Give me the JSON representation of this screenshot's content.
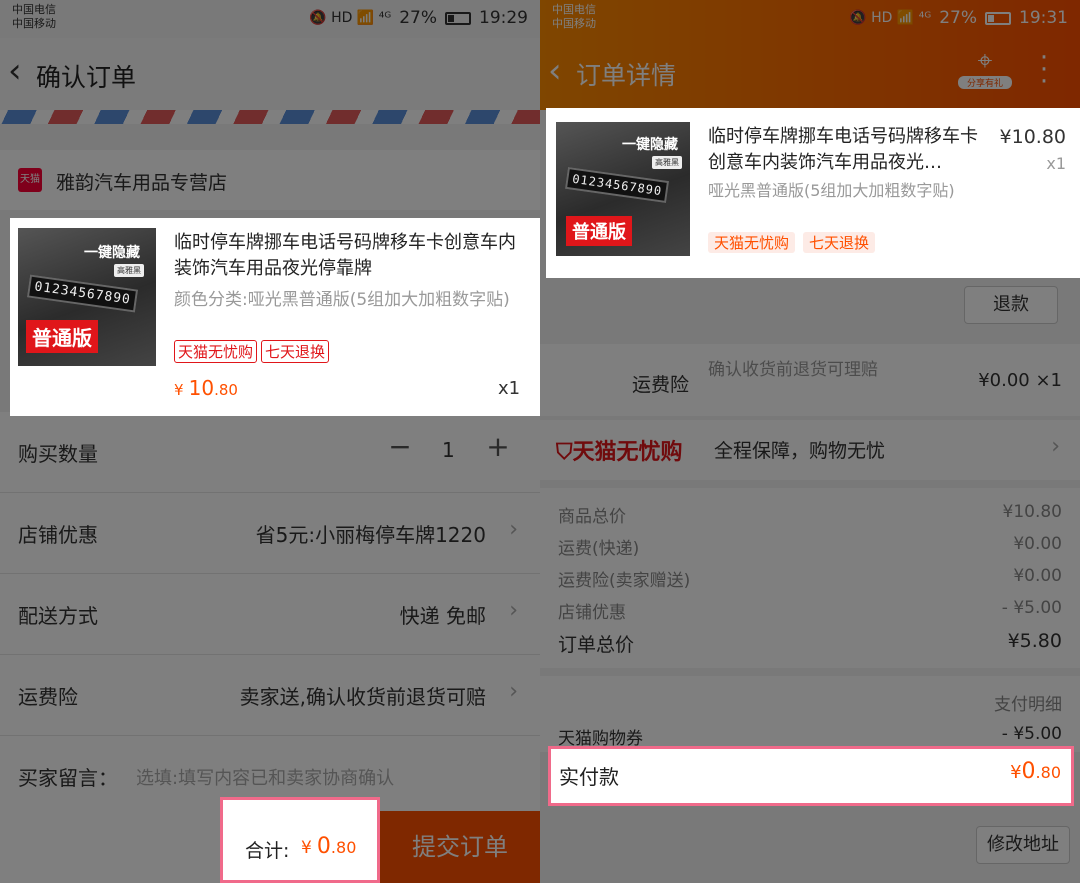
{
  "left": {
    "status": {
      "carrier1": "中国电信",
      "carrier2": "中国移动",
      "battery": "27%",
      "time": "19:29",
      "icons": "🔕 HD 📶 ⁴ᴳ"
    },
    "header": {
      "title": "确认订单",
      "back_icon": "chevron-left"
    },
    "store": {
      "badge": "天猫",
      "name": "雅韵汽车用品专营店"
    },
    "item": {
      "thumb": {
        "text": "一键隐藏",
        "mini": "高雅黑",
        "plate": "01234567890",
        "version": "普通版"
      },
      "title": "临时停车牌挪车电话号码牌移车卡创意车内装饰汽车用品夜光停靠牌",
      "sku": "颜色分类:哑光黑普通版(5组加大加粗数字贴)",
      "tags": [
        "天猫无忧购",
        "七天退换"
      ],
      "price_symbol": "¥",
      "price_int": "10",
      "price_dec": ".80",
      "qty": "x1"
    },
    "quantity": {
      "label": "购买数量",
      "minus": "−",
      "value": "1",
      "plus": "+"
    },
    "shop_discount": {
      "label": "店铺优惠",
      "value": "省5元:小丽梅停车牌1220"
    },
    "delivery": {
      "label": "配送方式",
      "value": "快递 免邮"
    },
    "insurance": {
      "label": "运费险",
      "value": "卖家送,确认收货前退货可赔"
    },
    "message": {
      "label": "买家留言：",
      "placeholder": "选填:填写内容已和卖家协商确认"
    },
    "total": {
      "label": "合计:",
      "symbol": "¥",
      "int": "0",
      "dec": ".80"
    },
    "submit": "提交订单"
  },
  "right": {
    "status": {
      "carrier1": "中国电信",
      "carrier2": "中国移动",
      "battery": "27%",
      "time": "19:31",
      "icons": "🔕 HD 📶 ⁴ᴳ"
    },
    "header": {
      "title": "订单详情",
      "share_caption": "分享有礼"
    },
    "item": {
      "thumb": {
        "text": "一键隐藏",
        "mini": "高雅黑",
        "plate": "01234567890",
        "version": "普通版"
      },
      "title": "临时停车牌挪车电话号码牌移车卡创意车内装饰汽车用品夜光…",
      "sku": "哑光黑普通版(5组加大加粗数字贴)",
      "tags": [
        "天猫无忧购",
        "七天退换"
      ],
      "price": "¥10.80",
      "qty": "x1"
    },
    "refund": "退款",
    "insurance": {
      "label": "运费险",
      "desc": "确认收货前退货可理赔",
      "value": "¥0.00 ×1"
    },
    "worry_free": {
      "brand": "天猫无忧购",
      "desc": "全程保障，购物无忧"
    },
    "fees": [
      {
        "k": "商品总价",
        "v": "¥10.80"
      },
      {
        "k": "运费(快递)",
        "v": "¥0.00"
      },
      {
        "k": "运费险(卖家赠送)",
        "v": "¥0.00"
      },
      {
        "k": "店铺优惠",
        "v": "- ¥5.00"
      }
    ],
    "order_total": {
      "k": "订单总价",
      "v": "¥5.80"
    },
    "pay_detail": "支付明细",
    "coupon": {
      "k": "天猫购物券",
      "v": "- ¥5.00"
    },
    "actual": {
      "k": "实付款",
      "symbol": "¥",
      "int": "0",
      "dec": ".80"
    },
    "change_address": "修改地址"
  },
  "colors": {
    "accent": "#ff5000",
    "tmall_red": "#e0161a",
    "highlight_border": "#f06a8a"
  }
}
